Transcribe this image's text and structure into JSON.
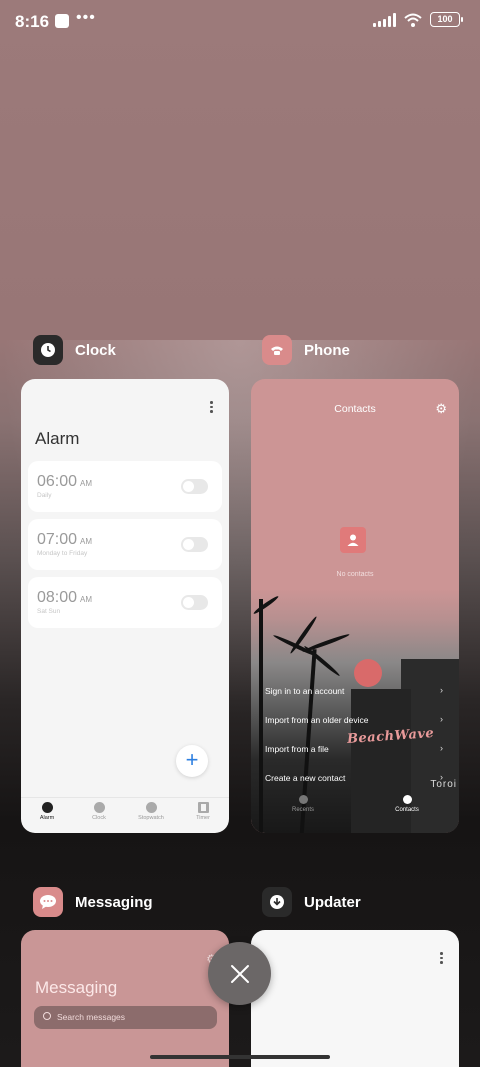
{
  "status_bar": {
    "time": "8:16",
    "battery": "100"
  },
  "apps": [
    {
      "name": "Clock",
      "screen": {
        "title": "Alarm",
        "alarms": [
          {
            "time": "06:00",
            "ampm": "AM",
            "repeat": "Daily",
            "enabled": false
          },
          {
            "time": "07:00",
            "ampm": "AM",
            "repeat": "Monday to Friday",
            "enabled": false
          },
          {
            "time": "08:00",
            "ampm": "AM",
            "repeat": "Sat Sun",
            "enabled": false
          }
        ],
        "add_label": "+",
        "tabs": [
          "Alarm",
          "Clock",
          "Stopwatch",
          "Timer"
        ],
        "active_tab": "Alarm"
      }
    },
    {
      "name": "Phone",
      "screen": {
        "title": "Contacts",
        "empty_text": "No contacts",
        "options": [
          "Sign in to an account",
          "Import from an older device",
          "Import from a file",
          "Create a new contact"
        ],
        "watermark": "BeachWave",
        "tabs": [
          "Recents",
          "Contacts"
        ],
        "active_tab": "Contacts",
        "sign_text": "Toroi"
      }
    },
    {
      "name": "Messaging",
      "screen": {
        "title": "Messaging",
        "search_placeholder": "Search messages"
      }
    },
    {
      "name": "Updater",
      "screen": {}
    }
  ],
  "colors": {
    "accent": "#2d7fe0",
    "phone_card": "#cc9595",
    "messaging_card": "#c99696"
  },
  "icons": {
    "close": "close-icon",
    "settings": "gear-icon"
  }
}
